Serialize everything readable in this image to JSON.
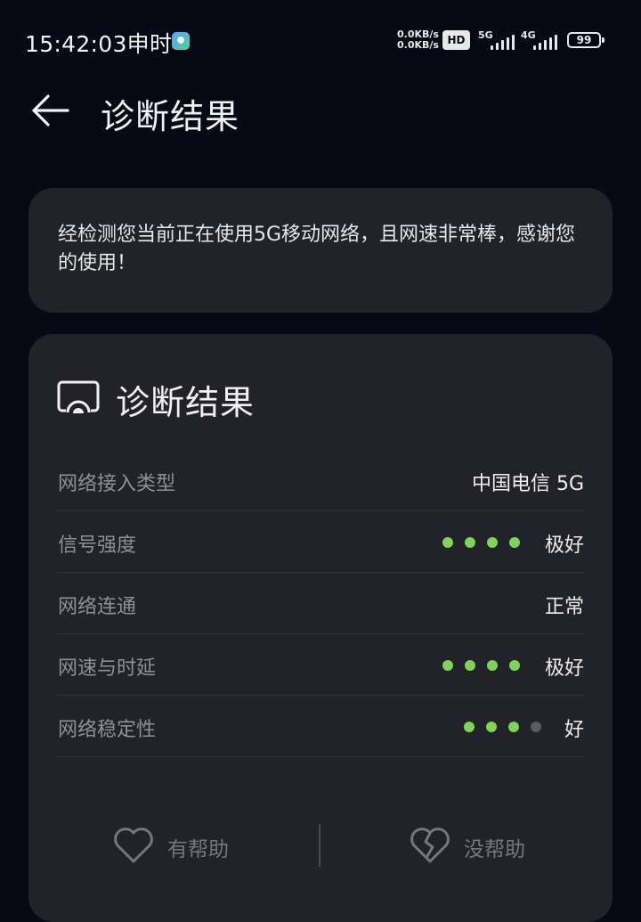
{
  "status_bar": {
    "time": "15:42:03申时",
    "net_up": "0.0KB/s",
    "net_down": "0.0KB/s",
    "hd_badge": "HD",
    "signal_1": "5G",
    "signal_2": "4G",
    "battery": "99"
  },
  "header": {
    "back_icon": "arrow-left-icon",
    "title": "诊断结果"
  },
  "summary": {
    "text": "经检测您当前正在使用5G移动网络，且网速非常棒，感谢您的使用！"
  },
  "result": {
    "icon": "cast-screen-icon",
    "title": "诊断结果",
    "rows": [
      {
        "label": "网络接入类型",
        "value": "中国电信 5G"
      },
      {
        "label": "信号强度",
        "value": "极好",
        "rating": 4,
        "rating_max": 4
      },
      {
        "label": "网络连通",
        "value": "正常"
      },
      {
        "label": "网速与时延",
        "value": "极好",
        "rating": 4,
        "rating_max": 4
      },
      {
        "label": "网络稳定性",
        "value": "好",
        "rating": 3,
        "rating_max": 4
      }
    ],
    "rating_color_on": "#7fd35b",
    "rating_color_off": "#5a5c61"
  },
  "feedback": {
    "helpful_label": "有帮助",
    "helpful_icon": "heart-icon",
    "not_helpful_label": "没帮助",
    "not_helpful_icon": "broken-heart-icon"
  }
}
